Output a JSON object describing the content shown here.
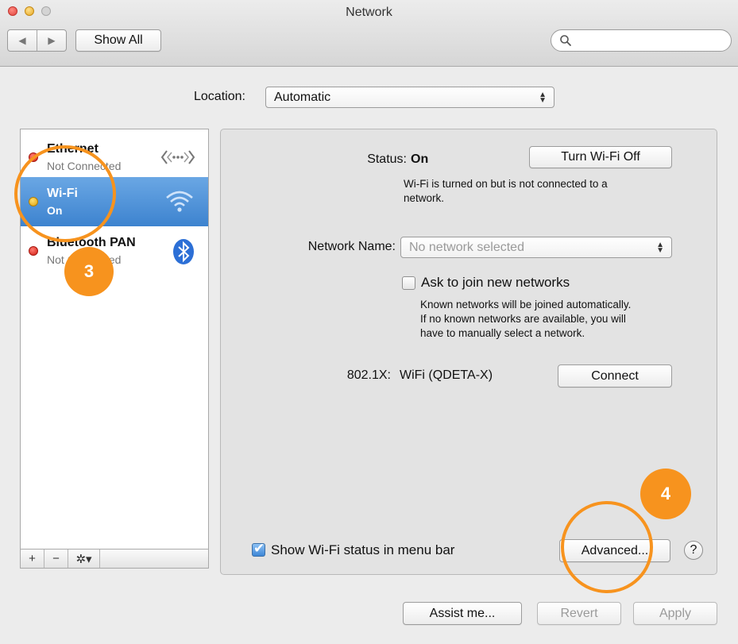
{
  "window": {
    "title": "Network"
  },
  "toolbar": {
    "back_glyph": "◀",
    "forward_glyph": "▶",
    "show_all": "Show All",
    "search_placeholder": ""
  },
  "location": {
    "label": "Location:",
    "value": "Automatic"
  },
  "services": [
    {
      "name": "Ethernet",
      "status": "Not Connected",
      "indicator": "red",
      "icon": "ethernet-icon",
      "selected": false
    },
    {
      "name": "Wi-Fi",
      "status": "On",
      "indicator": "yellow",
      "icon": "wifi-icon",
      "selected": true
    },
    {
      "name": "Bluetooth PAN",
      "status": "Not Connected",
      "indicator": "red",
      "icon": "bluetooth-icon",
      "selected": false
    }
  ],
  "sidebar_toolbar": {
    "add": "+",
    "remove": "−",
    "gear": "✲▾"
  },
  "details": {
    "status_label": "Status:",
    "status_value": "On",
    "wifi_toggle_button": "Turn Wi-Fi Off",
    "status_description_line1": "Wi-Fi is turned on but is not connected to a",
    "status_description_line2": "network.",
    "network_name_label": "Network Name:",
    "network_name_value": "No network selected",
    "ask_to_join_label": "Ask to join new networks",
    "ask_to_join_checked": false,
    "ask_note_line1": "Known networks will be joined automatically.",
    "ask_note_line2": "If no known networks are available, you will",
    "ask_note_line3": "have to manually select a network.",
    "dot1x_label": "802.1X:",
    "dot1x_value": "WiFi (QDETA-X)",
    "connect_button": "Connect",
    "show_status_label": "Show Wi-Fi status in menu bar",
    "show_status_checked": true,
    "advanced_button": "Advanced...",
    "help_button": "?"
  },
  "footer": {
    "assist_button": "Assist me...",
    "revert_button": "Revert",
    "apply_button": "Apply"
  },
  "annotations": [
    {
      "number": "3"
    },
    {
      "number": "4"
    }
  ],
  "colors": {
    "selection": "#4a8fd8",
    "annotation": "#f7931e",
    "indicator_red": "#d01d12",
    "indicator_yellow": "#e0a10a"
  }
}
